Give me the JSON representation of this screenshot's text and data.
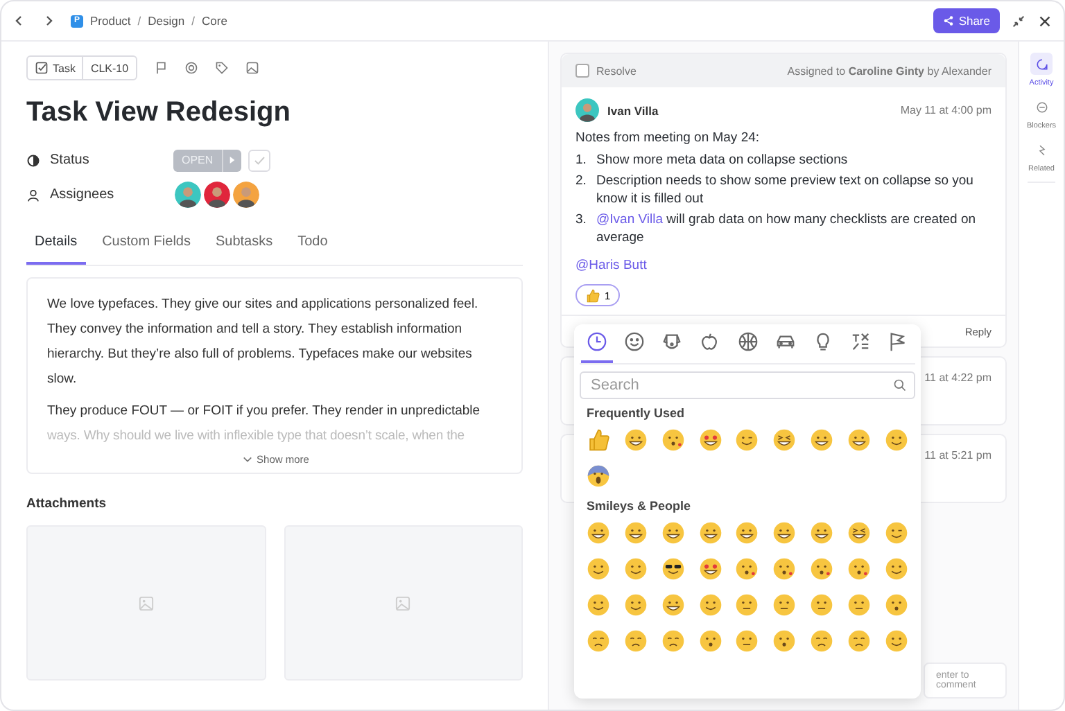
{
  "topbar": {
    "space_badge": "P",
    "breadcrumb": [
      "Product",
      "Design",
      "Core"
    ],
    "separator": "/",
    "share": "Share"
  },
  "task": {
    "type_label": "Task",
    "id": "CLK-10",
    "title": "Task View Redesign"
  },
  "fields": [
    {
      "kind": "status",
      "label": "Status",
      "value": "OPEN",
      "completed": false
    },
    {
      "kind": "assignees",
      "label": "Assignees",
      "avatars": [
        {
          "color": "#3cc6c0"
        },
        {
          "color": "#e0263c"
        },
        {
          "color": "#f4a340"
        }
      ]
    }
  ],
  "tabs": [
    {
      "label": "Details",
      "selected": true
    },
    {
      "label": "Custom Fields",
      "selected": false
    },
    {
      "label": "Subtasks",
      "selected": false
    },
    {
      "label": "Todo",
      "selected": false
    }
  ],
  "description": {
    "paragraphs": [
      "We love typefaces. They give our sites and applications personalized feel. They convey the information and tell a story. They establish information hierarchy. But they’re also full of problems. Typefaces make our websites slow.",
      "They produce FOUT — or FOIT if you prefer. They render in unpredictable"
    ],
    "faded": "ways. Why should we live with inflexible type that doesn’t scale, when the",
    "show_more": "Show more"
  },
  "attachments": {
    "title": "Attachments",
    "items": [
      {
        "kind": "placeholder"
      },
      {
        "kind": "placeholder"
      }
    ]
  },
  "activity": {
    "resolve": {
      "label": "Resolve",
      "checked": false
    },
    "assigned": "Assigned to **Caroline Ginty** by Alexander",
    "comment": {
      "author": "Ivan Villa",
      "time": "May 11 at 4:00 pm",
      "intro": "Notes from meeting on May 24:",
      "items": [
        {
          "number": "1.",
          "text": "Show more meta data on collapse sections"
        },
        {
          "number": "2.",
          "text": "Description needs to show some preview text on collapse so you know it is filled out"
        },
        {
          "number": "3.",
          "mention": "@Ivan Villa",
          "text": " will grab data on how many checklists are created on average"
        }
      ],
      "footer_mention": "@Haris Butt",
      "reaction_count": "1"
    },
    "reply": "Reply",
    "hidden_times": [
      "11 at 4:22 pm",
      "11 at 5:21 pm"
    ],
    "comment_hint": "enter to comment"
  },
  "sidebar": [
    {
      "kind": "activity",
      "label": "Activity",
      "selected": true
    },
    {
      "kind": "blockers",
      "label": "Blockers",
      "selected": false
    },
    {
      "kind": "related",
      "label": "Related",
      "selected": false
    }
  ],
  "emoji_picker": {
    "categories": [
      {
        "kind": "clock",
        "selected": true
      },
      {
        "kind": "smiley",
        "selected": false
      },
      {
        "kind": "dog",
        "selected": false
      },
      {
        "kind": "apple",
        "selected": false
      },
      {
        "kind": "ball",
        "selected": false
      },
      {
        "kind": "car",
        "selected": false
      },
      {
        "kind": "bulb",
        "selected": false
      },
      {
        "kind": "symbols",
        "selected": false
      },
      {
        "kind": "flag",
        "selected": false
      }
    ],
    "search_placeholder": "Search",
    "sections": [
      {
        "title": "Frequently Used",
        "emojis": [
          {
            "kind": "thumbs"
          },
          {
            "kind": "grin"
          },
          {
            "kind": "kiss"
          },
          {
            "kind": "hearts"
          },
          {
            "kind": "wink"
          },
          {
            "kind": "squint"
          },
          {
            "kind": "grin"
          },
          {
            "kind": "grin"
          },
          {
            "kind": "smile"
          },
          {
            "kind": "scream"
          }
        ]
      },
      {
        "title": "Smileys & People",
        "emojis": [
          {
            "kind": "grin"
          },
          {
            "kind": "grin"
          },
          {
            "kind": "grin"
          },
          {
            "kind": "grin"
          },
          {
            "kind": "grin"
          },
          {
            "kind": "grin"
          },
          {
            "kind": "grin"
          },
          {
            "kind": "squint"
          },
          {
            "kind": "wink"
          },
          {
            "kind": "smile"
          },
          {
            "kind": "smile"
          },
          {
            "kind": "cool"
          },
          {
            "kind": "hearts"
          },
          {
            "kind": "kiss"
          },
          {
            "kind": "kiss"
          },
          {
            "kind": "kiss"
          },
          {
            "kind": "kiss"
          },
          {
            "kind": "smile"
          },
          {
            "kind": "smile"
          },
          {
            "kind": "smile"
          },
          {
            "kind": "grin"
          },
          {
            "kind": "smile"
          },
          {
            "kind": "neutral"
          },
          {
            "kind": "neutral"
          },
          {
            "kind": "neutral"
          },
          {
            "kind": "neutral"
          },
          {
            "kind": "open"
          },
          {
            "kind": "sad"
          },
          {
            "kind": "sad"
          },
          {
            "kind": "sad"
          },
          {
            "kind": "open"
          },
          {
            "kind": "neutral"
          },
          {
            "kind": "open"
          },
          {
            "kind": "sad"
          },
          {
            "kind": "sad"
          },
          {
            "kind": "smile"
          }
        ]
      }
    ]
  }
}
